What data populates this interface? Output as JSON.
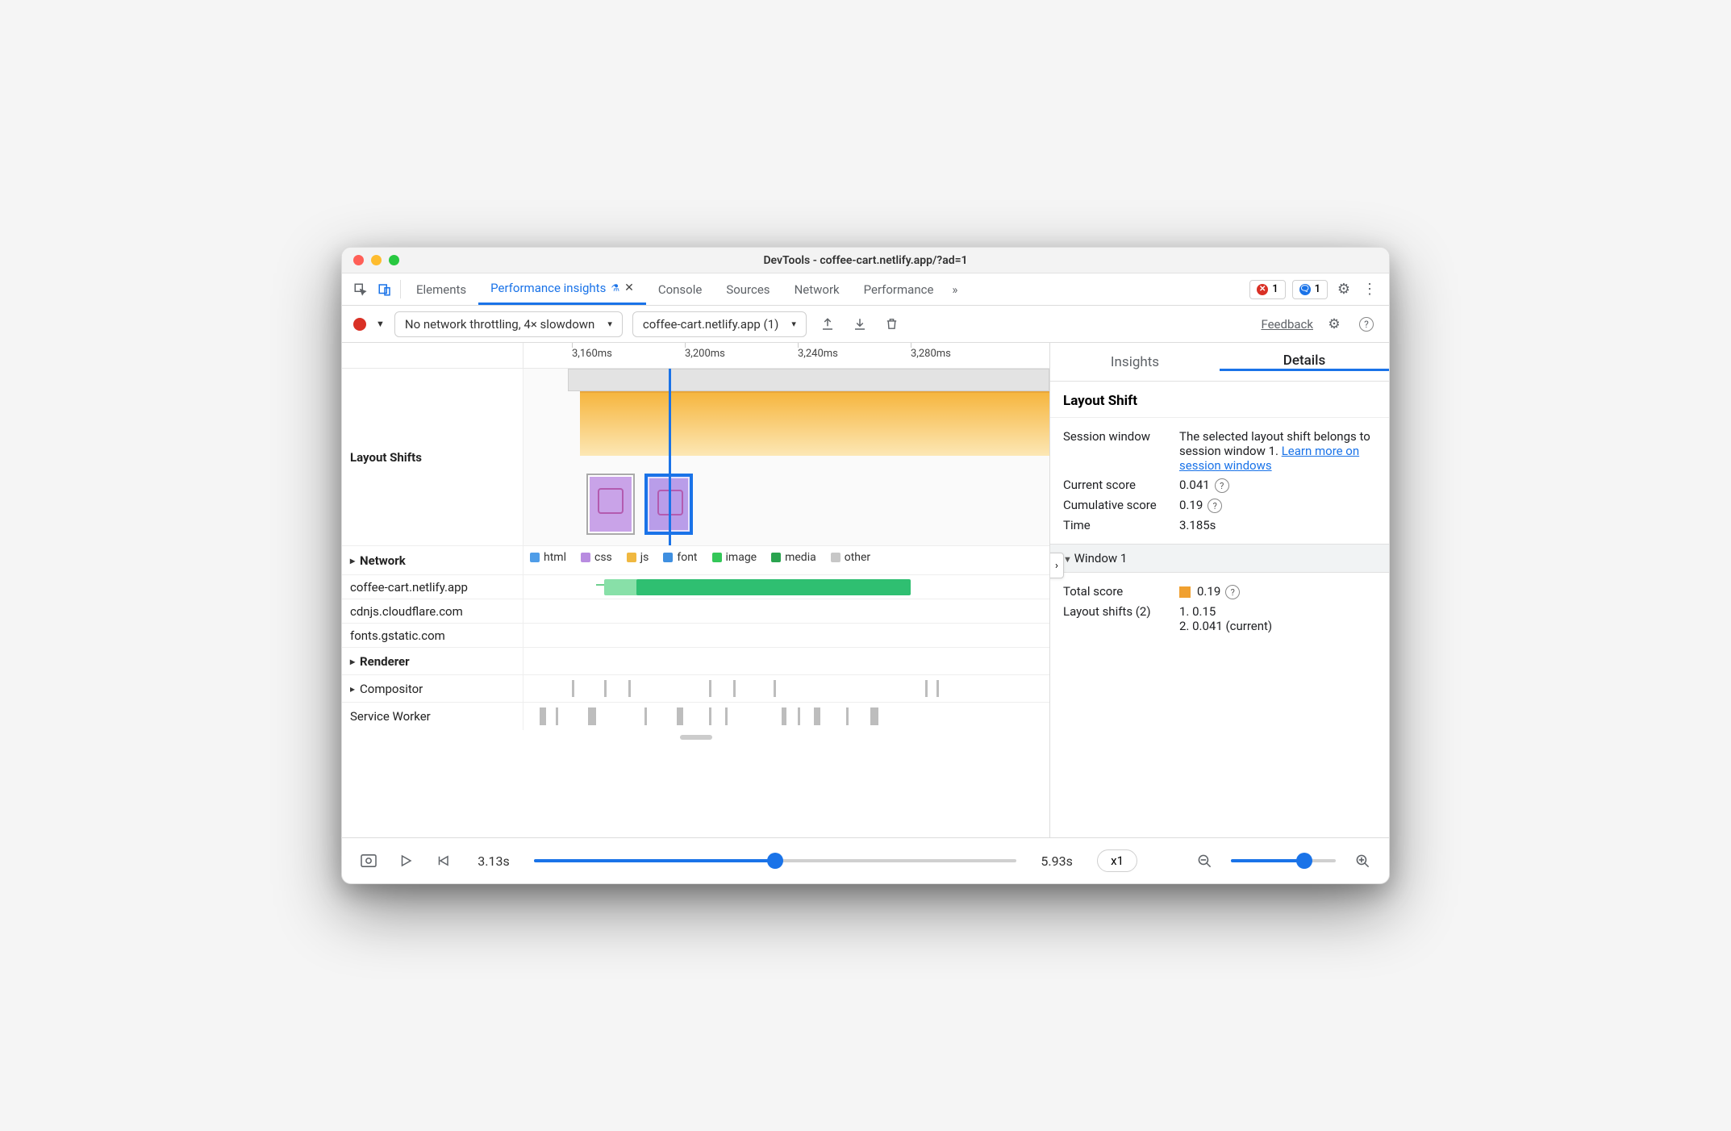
{
  "window": {
    "title": "DevTools - coffee-cart.netlify.app/?ad=1"
  },
  "tabs": {
    "items": [
      "Elements",
      "Performance insights",
      "Console",
      "Sources",
      "Network",
      "Performance"
    ],
    "active_index": 1,
    "more_icon": "»",
    "errors_count": "1",
    "messages_count": "1"
  },
  "toolbar": {
    "throttling": "No network throttling, 4× slowdown",
    "recording": "coffee-cart.netlify.app (1)",
    "feedback": "Feedback"
  },
  "timeline": {
    "ticks": [
      "3,160ms",
      "3,200ms",
      "3,240ms",
      "3,280ms"
    ],
    "layout_shifts_label": "Layout Shifts",
    "network_label": "Network",
    "legend": [
      "html",
      "css",
      "js",
      "font",
      "image",
      "media",
      "other"
    ],
    "network_rows": [
      "coffee-cart.netlify.app",
      "cdnjs.cloudflare.com",
      "fonts.gstatic.com"
    ],
    "renderer_label": "Renderer",
    "compositor_label": "Compositor",
    "service_worker_label": "Service Worker"
  },
  "details": {
    "tabs": [
      "Insights",
      "Details"
    ],
    "active_index": 1,
    "section_title": "Layout Shift",
    "session_window": {
      "label": "Session window",
      "text_prefix": "The selected layout shift belongs to session window 1. ",
      "link": "Learn more on session windows"
    },
    "current_score": {
      "label": "Current score",
      "value": "0.041"
    },
    "cumulative_score": {
      "label": "Cumulative score",
      "value": "0.19"
    },
    "time": {
      "label": "Time",
      "value": "3.185s"
    },
    "window1": {
      "header": "Window 1",
      "total_score": {
        "label": "Total score",
        "value": "0.19"
      },
      "layout_shifts": {
        "label": "Layout shifts (2)",
        "items": [
          "1. 0.15",
          "2. 0.041 (current)"
        ]
      }
    }
  },
  "playback": {
    "start": "3.13s",
    "end": "5.93s",
    "speed": "x1"
  }
}
